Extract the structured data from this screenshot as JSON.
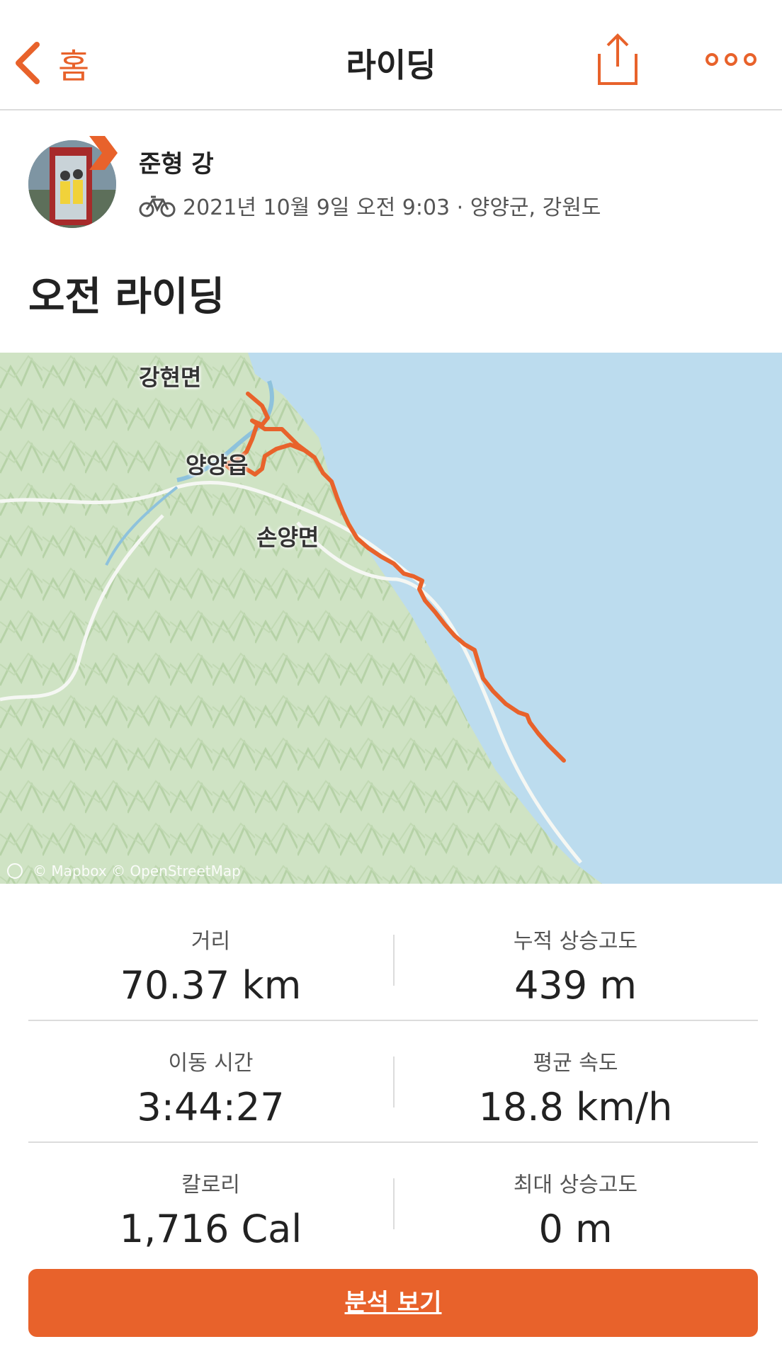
{
  "header": {
    "back_label": "홈",
    "title": "라이딩"
  },
  "athlete": {
    "name": "준형 강",
    "meta": "2021년 10월 9일 오전 9:03 · 양양군, 강원도",
    "activity_icon": "bike-icon"
  },
  "activity": {
    "title": "오전 라이딩"
  },
  "map": {
    "places": [
      "강현면",
      "양양읍",
      "손양면"
    ],
    "attribution": "© Mapbox © OpenStreetMap",
    "route_color": "#e8622b",
    "sea_color": "#bcdcee",
    "land_color": "#d4e6c9"
  },
  "stats": [
    {
      "label": "거리",
      "value": "70.37 km"
    },
    {
      "label": "누적 상승고도",
      "value": "439 m"
    },
    {
      "label": "이동 시간",
      "value": "3:44:27"
    },
    {
      "label": "평균 속도",
      "value": "18.8 km/h"
    },
    {
      "label": "칼로리",
      "value": "1,716 Cal"
    },
    {
      "label": "최대 상승고도",
      "value": "0 m"
    }
  ],
  "cta": {
    "label": "분석 보기"
  },
  "colors": {
    "accent": "#e8622b"
  }
}
